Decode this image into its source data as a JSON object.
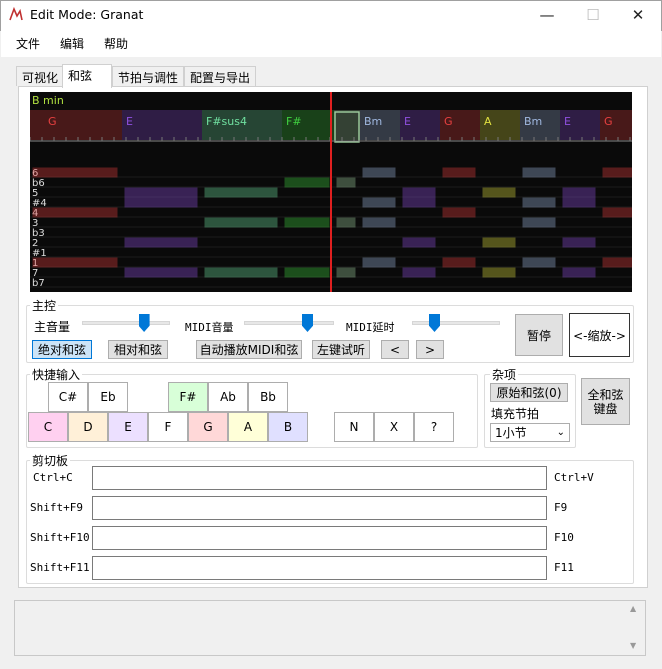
{
  "window": {
    "title": "Edit Mode: Granat",
    "minimize": "—",
    "maximize": "☐",
    "close": "✕"
  },
  "menu": [
    "文件",
    "编辑",
    "帮助"
  ],
  "tabs": [
    "可视化",
    "和弦",
    "节拍与调性",
    "配置与导出"
  ],
  "active_tab": 1,
  "visual": {
    "key_label": "B min",
    "chords": [
      {
        "label": "G",
        "color": "#e84040"
      },
      {
        "label": "E",
        "color": "#9050e0"
      },
      {
        "label": "F#sus4",
        "color": "#70e0a0"
      },
      {
        "label": "F#",
        "color": "#40d040"
      },
      {
        "label": "",
        "color": "#a0d0a0"
      },
      {
        "label": "Bm",
        "color": "#a0b8e0"
      },
      {
        "label": "E",
        "color": "#9050e0"
      },
      {
        "label": "G",
        "color": "#e84040"
      },
      {
        "label": "A",
        "color": "#e0e040"
      },
      {
        "label": "Bm",
        "color": "#a0b8e0"
      },
      {
        "label": "E",
        "color": "#9050e0"
      },
      {
        "label": "G",
        "color": "#e84040"
      }
    ],
    "pitch_labels": [
      "6",
      "b6",
      "5",
      "#4",
      "4",
      "3",
      "b3",
      "2",
      "#1",
      "1",
      "7",
      "b7"
    ]
  },
  "main_control": {
    "label": "主控",
    "volume_label": "主音量",
    "volume_value": 0.7,
    "midi_volume_label": "MIDI音量",
    "midi_volume_value": 0.7,
    "midi_delay_label": "MIDI延时",
    "midi_delay_value": 0.25,
    "absolute_chord": "绝对和弦",
    "relative_chord": "相对和弦",
    "autoplay": "自动播放MIDI和弦",
    "left_click": "左键试听",
    "prev": "<",
    "next": ">",
    "pause": "暂停",
    "zoom": "<-缩放->"
  },
  "quick_input": {
    "label": "快捷输入",
    "sharps": [
      "C#",
      "Eb",
      "F#",
      "Ab",
      "Bb"
    ],
    "naturals": [
      "C",
      "D",
      "E",
      "F",
      "G",
      "A",
      "B"
    ],
    "specials": [
      "N",
      "X",
      "?"
    ],
    "natural_colors": [
      "#ffd0f0",
      "#fff0d8",
      "#ece0ff",
      "#ffffff",
      "#ffd8d8",
      "#ffffd8",
      "#e0e0ff"
    ],
    "sharp_colors": [
      "#ffffff",
      "#ffffff",
      "#d8ffd8",
      "#ffffff",
      "#ffffff"
    ]
  },
  "misc": {
    "label": "杂项",
    "original_chord": "原始和弦(0)",
    "fill_beat": "填充节拍",
    "fill_value": "1小节",
    "full_keyboard": "全和弦键盘"
  },
  "clipboard": {
    "label": "剪切板",
    "rows": [
      {
        "left": "Ctrl+C",
        "right": "Ctrl+V"
      },
      {
        "left": "Shift+F9",
        "right": "F9"
      },
      {
        "left": "Shift+F10",
        "right": "F10"
      },
      {
        "left": "Shift+F11",
        "right": "F11"
      }
    ]
  }
}
